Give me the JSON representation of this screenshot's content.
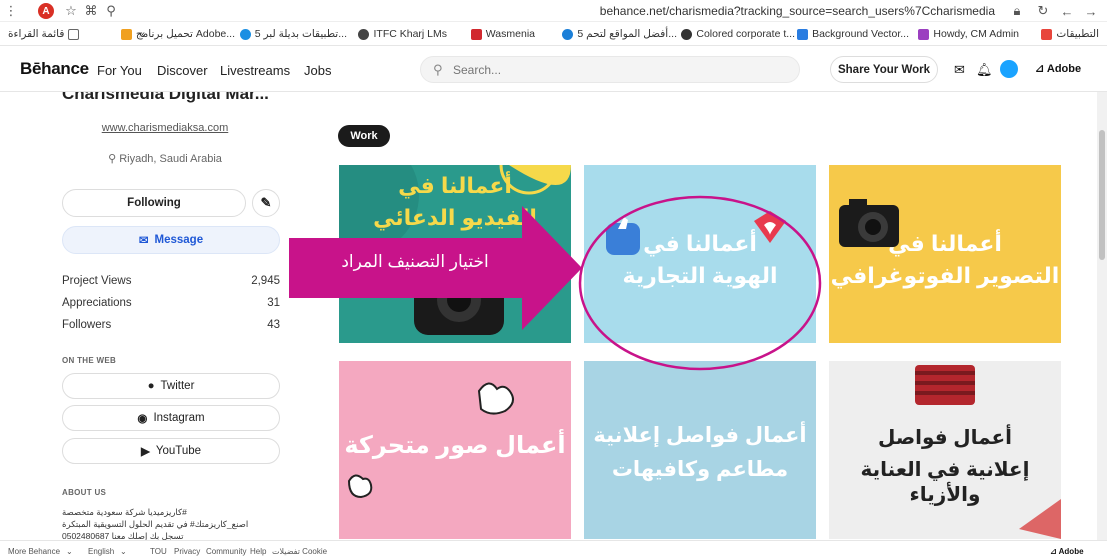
{
  "browser": {
    "url": "behance.net/charismedia?tracking_source=search_users%7Ccharismedia",
    "profile_initial": "A"
  },
  "bookmarks": [
    {
      "label": "التطبيقات",
      "color": "#e8453c"
    },
    {
      "label": "Howdy, CM Admin",
      "color": "#9b3fc0"
    },
    {
      "label": "Background Vector...",
      "color": "#2a7de1"
    },
    {
      "label": "Colored corporate t...",
      "color": "#333333"
    },
    {
      "label": "5 أفضل المواقع لتحم...",
      "color": "#1b7fd8"
    },
    {
      "label": "Wasmenia",
      "color": "#d1282e"
    },
    {
      "label": "ITFC Kharj LMs",
      "color": "#444444"
    },
    {
      "label": "5 تطبيقات بديلة لبر...",
      "color": "#1a8fe3"
    },
    {
      "label": "تحميل برنامج Adobe...",
      "color": "#f0a020"
    },
    {
      "label": "«",
      "color": ""
    },
    {
      "label": "قائمة القراءة",
      "color": "#666666"
    }
  ],
  "nav": {
    "logo": "Bēhance",
    "links": [
      "For You",
      "Discover",
      "Livestreams",
      "Jobs"
    ],
    "search_placeholder": "Search...",
    "share_label": "Share Your Work",
    "adobe_label": "Adobe"
  },
  "profile": {
    "name": "Charismedia Digital Mar...",
    "website": "www.charismediaksa.com",
    "location": "Riyadh, Saudi Arabia",
    "following_label": "Following",
    "message_label": "Message",
    "stats": [
      {
        "label": "Project Views",
        "value": "2,945"
      },
      {
        "label": "Appreciations",
        "value": "31"
      },
      {
        "label": "Followers",
        "value": "43"
      }
    ],
    "on_the_web_heading": "ON THE WEB",
    "social": [
      "Twitter",
      "Instagram",
      "YouTube"
    ],
    "about_heading": "ABOUT US",
    "about_lines": [
      "كاريزميديا شركة سعودية متخصصة#",
      "اصنع_كاريزمتك# في تقديم الحلول التسويقية المبتكرة",
      "0502480687 تسجل بك إصلك معنا"
    ]
  },
  "work_tag": "Work",
  "cards": [
    {
      "line1": "أعمالنا في",
      "line2": "الفيديو الدعائي",
      "bg": "#2a9a8c"
    },
    {
      "line1": "أعمالنا في",
      "line2": "الهوية التجارية",
      "bg": "#a8dcec"
    },
    {
      "line1": "أعمالنا في",
      "line2": "التصوير الفوتوغرافي",
      "bg": "#f6c94a"
    },
    {
      "line1": "أعمال صور متحركة",
      "line2": "",
      "bg": "#f4a8c0"
    },
    {
      "line1": "أعمال فواصل إعلانية",
      "line2": "مطاعم وكافيهات",
      "bg": "#a8d4e4"
    },
    {
      "line1": "أعمال فواصل",
      "line2": "إعلانية في العناية والأزياء",
      "bg": "#eeeeee"
    }
  ],
  "annotation": {
    "text": "اختيار التصنيف المراد",
    "color": "#c8138a"
  },
  "footer": {
    "links": [
      "More Behance",
      "English",
      "TOU",
      "Privacy",
      "Community",
      "Help",
      "تفضيلات Cookie"
    ],
    "adobe": "Adobe"
  }
}
